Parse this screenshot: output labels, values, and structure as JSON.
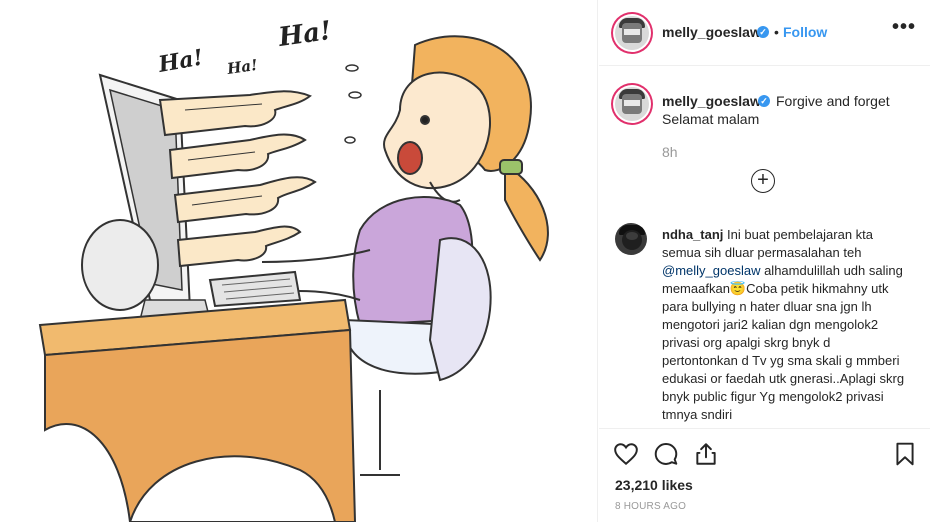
{
  "post": {
    "author": "melly_goeslaw",
    "follow_label": "Follow",
    "dot": "•",
    "more_label": "•••",
    "verified_mark": "✓"
  },
  "caption": {
    "user": "melly_goeslaw",
    "text_line1": "Forgive and forget",
    "text_line2": "Selamat malam",
    "time": "8h"
  },
  "load_more": "+",
  "comment": {
    "user": "ndha_tanj",
    "text_a": " Ini buat pembelajaran kta semua sih dluar permasalahan teh ",
    "mention": "@melly_goeslaw",
    "text_b": " alhamdulillah udh saling memaafkan😇Coba petik hikmahny utk para bullying n hater dluar sna jgn lh mengotori jari2 kalian dgn mengolok2 privasi org apalgi skrg bnyk d pertontonkan d Tv yg sma skali g mmberi edukasi or faedah utk gnerasi..Aplagi skrg bnyk public figur Yg mengolok2 privasi tmnya sndiri"
  },
  "illustration": {
    "ha_1": "Ha!",
    "ha_2": "Ha!",
    "ha_3": "Ha!"
  },
  "stats": {
    "likes": "23,210 likes",
    "posted": "8 HOURS AGO"
  },
  "icons": [
    "heart-icon",
    "comment-icon",
    "share-icon",
    "bookmark-icon",
    "more-icon",
    "add-circle-icon",
    "verified-icon"
  ],
  "colors": {
    "link": "#3897f0",
    "mention": "#003569",
    "muted": "#999999",
    "desk": "#e8a85a",
    "hair": "#f0b560",
    "shirt": "#c9a8d8"
  }
}
